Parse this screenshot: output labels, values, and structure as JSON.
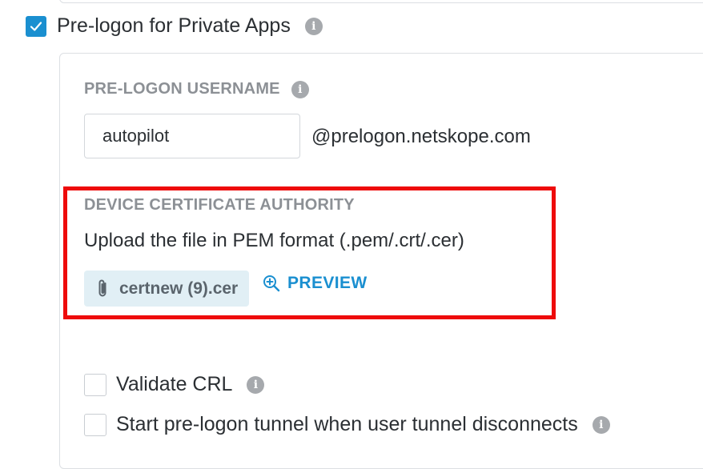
{
  "prelogon": {
    "label": "Pre-logon for Private Apps",
    "checked": true
  },
  "username": {
    "label": "PRE-LOGON USERNAME",
    "value": "autopilot",
    "suffix": "@prelogon.netskope.com"
  },
  "device_ca": {
    "label": "DEVICE CERTIFICATE AUTHORITY",
    "help": "Upload the file in PEM format (.pem/.crt/.cer)",
    "file_name": "certnew (9).cer",
    "preview_label": "PREVIEW"
  },
  "validate_crl": {
    "label": "Validate CRL",
    "checked": false
  },
  "start_tunnel": {
    "label": "Start pre-logon tunnel when user tunnel disconnects",
    "checked": false
  },
  "icons": {
    "info": "info-icon",
    "check": "checkmark-icon",
    "attachment": "paperclip-icon",
    "preview": "zoom-in-icon"
  },
  "colors": {
    "accent": "#1a8fd0",
    "highlight": "#ee0b0b",
    "chip_bg": "#e1eff5",
    "label_gray": "#8c9095"
  }
}
